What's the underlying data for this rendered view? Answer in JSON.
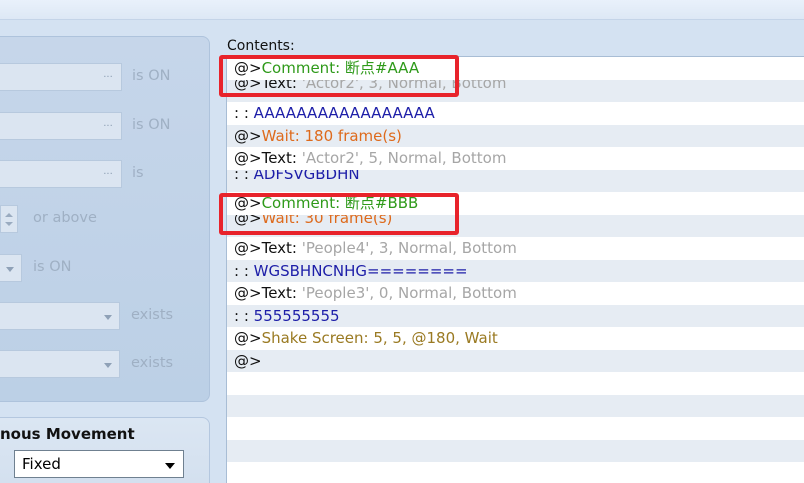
{
  "conditions": [
    {
      "suffix": "is ON"
    },
    {
      "suffix": "is ON"
    },
    {
      "suffix": "is"
    },
    {
      "suffix": "or above"
    },
    {
      "suffix": "is ON"
    },
    {
      "suffix": "exists"
    },
    {
      "suffix": "exists"
    }
  ],
  "movement": {
    "title": "nous Movement",
    "selected": "Fixed"
  },
  "contents": {
    "label": "Contents:",
    "rows": [
      {
        "prefix": "@>",
        "cmd": "Comment: 断点#AAA",
        "args": ""
      },
      {
        "prefix": "@>",
        "cmd": "Text: ",
        "args": "'Actor2', 3, Normal, Bottom"
      },
      {
        "prefix": " :",
        "cmd": "       : ",
        "args": "AAAAAAAAAAAAAAAAA"
      },
      {
        "prefix": "@>",
        "cmd": "Wait: 180 frame(s)",
        "args": ""
      },
      {
        "prefix": "@>",
        "cmd": "Text: ",
        "args": "'Actor2', 5, Normal, Bottom"
      },
      {
        "prefix": " :",
        "cmd": "       : ",
        "args": "ADFSVGBDHN"
      },
      {
        "prefix": "@>",
        "cmd": "Comment: 断点#BBB",
        "args": ""
      },
      {
        "prefix": "@>",
        "cmd": "Wait: 30 frame(s)",
        "args": ""
      },
      {
        "prefix": "@>",
        "cmd": "Text: ",
        "args": "'People4', 3, Normal, Bottom"
      },
      {
        "prefix": " :",
        "cmd": "       : ",
        "args": "WGSBHNCNHG========"
      },
      {
        "prefix": "@>",
        "cmd": "Text: ",
        "args": "'People3', 0, Normal, Bottom"
      },
      {
        "prefix": " :",
        "cmd": "       : ",
        "args": "555555555"
      },
      {
        "prefix": "@>",
        "cmd": "Shake Screen: 5, 5, @180, Wait",
        "args": ""
      },
      {
        "prefix": "@>",
        "cmd": "",
        "args": ""
      }
    ]
  },
  "highlight_color": "#e8232b"
}
